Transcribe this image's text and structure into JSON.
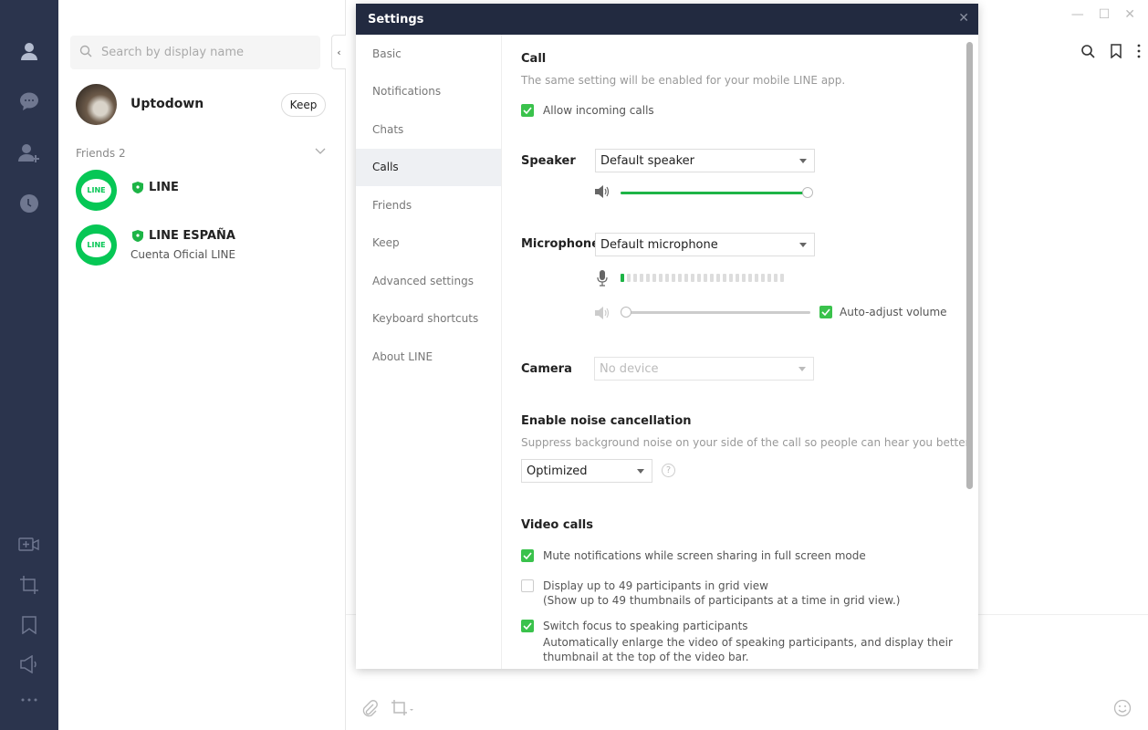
{
  "rail": {
    "icons": [
      "person-icon",
      "chat-bubble-icon",
      "add-friend-icon",
      "clock-icon",
      "video-call-icon",
      "crop-screenshot-icon",
      "bookmark-icon",
      "announcement-icon",
      "more-icon"
    ]
  },
  "friends_panel": {
    "search_placeholder": "Search by display name",
    "me": {
      "name": "Uptodown",
      "keep_label": "Keep"
    },
    "friends_header": "Friends 2",
    "friends": [
      {
        "name": "LINE",
        "subtitle": "",
        "logo_text": "LINE"
      },
      {
        "name": "LINE ESPAÑA",
        "subtitle": "Cuenta Oficial LINE",
        "logo_text": "LINE"
      }
    ]
  },
  "window": {
    "minimize": "—",
    "maximize": "☐",
    "close": "✕"
  },
  "settings": {
    "title": "Settings",
    "close": "✕",
    "nav": [
      {
        "label": "Basic",
        "active": false
      },
      {
        "label": "Notifications",
        "active": false
      },
      {
        "label": "Chats",
        "active": false
      },
      {
        "label": "Calls",
        "active": true
      },
      {
        "label": "Friends",
        "active": false
      },
      {
        "label": "Keep",
        "active": false
      },
      {
        "label": "Advanced settings",
        "active": false
      },
      {
        "label": "Keyboard shortcuts",
        "active": false
      },
      {
        "label": "About LINE",
        "active": false
      }
    ],
    "call": {
      "heading": "Call",
      "description": "The same setting will be enabled for your mobile LINE app.",
      "allow_incoming": {
        "label": "Allow incoming calls",
        "checked": true
      }
    },
    "speaker": {
      "label": "Speaker",
      "selected": "Default speaker",
      "volume_percent": 100
    },
    "microphone": {
      "label": "Microphone",
      "selected": "Default microphone",
      "level_bars_total": 26,
      "level_bars_active": 1,
      "volume_percent": 0,
      "auto_adjust": {
        "label": "Auto-adjust volume",
        "checked": true
      }
    },
    "camera": {
      "label": "Camera",
      "selected": "No device",
      "disabled": true
    },
    "noise": {
      "heading": "Enable noise cancellation",
      "description": "Suppress background noise on your side of the call so people can hear you better.",
      "selected": "Optimized",
      "help": "?"
    },
    "video_calls": {
      "heading": "Video calls",
      "options": [
        {
          "label": "Mute notifications while screen sharing in full screen mode",
          "detail": "",
          "checked": true
        },
        {
          "label": "Display up to 49 participants in grid view",
          "detail": "(Show up to 49 thumbnails of participants at a time in grid view.)",
          "checked": false
        },
        {
          "label": "Switch focus to speaking participants",
          "detail": "Automatically enlarge the video of speaking participants, and display their",
          "detail2": "thumbnail at the top of the video bar.",
          "checked": true
        }
      ]
    }
  }
}
